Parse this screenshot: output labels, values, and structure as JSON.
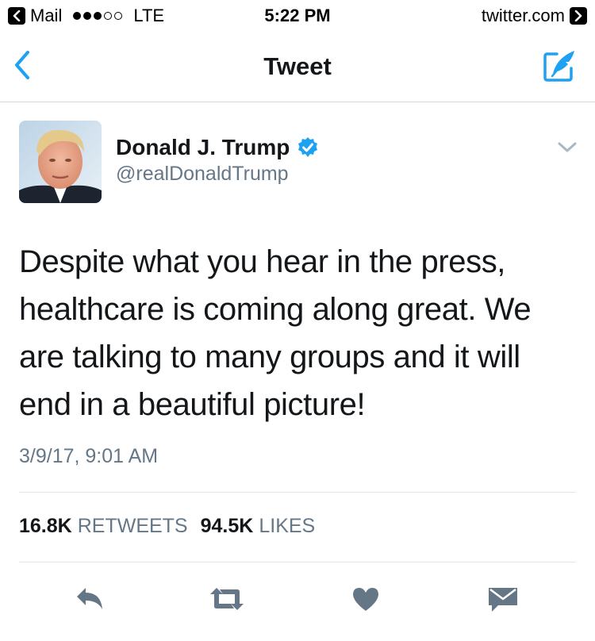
{
  "status_bar": {
    "back_app": "Mail",
    "network": "LTE",
    "time": "5:22 PM",
    "url": "twitter.com",
    "signal_strength": 3,
    "signal_max": 5
  },
  "nav": {
    "title": "Tweet",
    "back_icon": "chevron-left-icon",
    "compose_icon": "compose-tweet-icon",
    "accent_color": "#1da1f2"
  },
  "tweet": {
    "author_name": "Donald J. Trump",
    "author_handle": "@realDonaldTrump",
    "verified": true,
    "text": "Despite what you hear in the press, healthcare is coming along great. We are talking to many groups and it will end in a beautiful picture!",
    "timestamp": "3/9/17, 9:01 AM",
    "retweets_count": "16.8K",
    "retweets_label": "RETWEETS",
    "likes_count": "94.5K",
    "likes_label": "LIKES"
  },
  "actions": [
    {
      "name": "reply",
      "icon": "reply-icon"
    },
    {
      "name": "retweet",
      "icon": "retweet-icon"
    },
    {
      "name": "like",
      "icon": "heart-icon"
    },
    {
      "name": "direct-message",
      "icon": "envelope-icon"
    }
  ],
  "colors": {
    "text": "#14171a",
    "secondary_text": "#657786",
    "icon_gray": "#657786",
    "verified_blue": "#1da1f2",
    "divider": "#e1e8ed"
  }
}
